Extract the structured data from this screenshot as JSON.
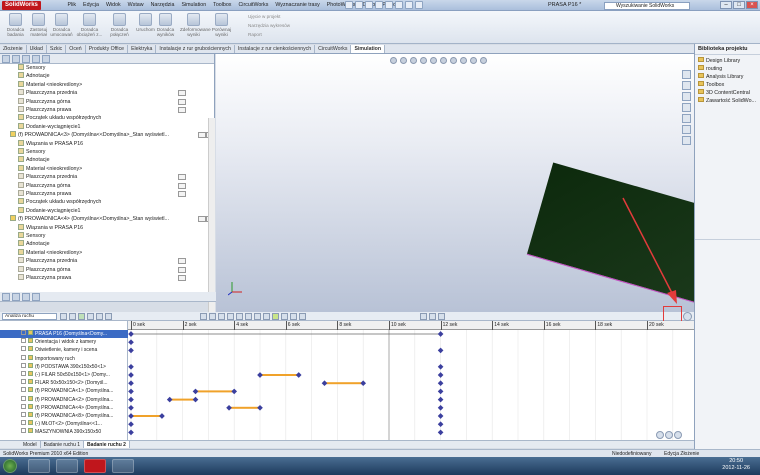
{
  "app": {
    "logo": "SolidWorks",
    "document_title": "PRASA P16 *",
    "search_placeholder": "Wyszukiwanie SolidWorks"
  },
  "menus": [
    "Plik",
    "Edycja",
    "Widok",
    "Wstaw",
    "Narzędzia",
    "Simulation",
    "Toolbox",
    "CircuitWorks",
    "Wyznaczanie trasy",
    "PhotoWorks",
    "Okno",
    "Pomoc"
  ],
  "ribbon": {
    "buttons": [
      {
        "label": "Doradca\nbadania"
      },
      {
        "label": "Zastosuj\nmateriał"
      },
      {
        "label": "Doradca\numocowań"
      },
      {
        "label": "Doradca\nobciążeń z..."
      },
      {
        "label": "Doradca\npołączeń"
      },
      {
        "label": "Uruchom"
      },
      {
        "label": "Doradca\nwyników"
      },
      {
        "label": "Zdeformowane\nwyniki"
      },
      {
        "label": "Porównaj\nwyniki"
      }
    ],
    "small_items": [
      "Ujęcie w projekt",
      "Narzędzia wykresów",
      "Raport"
    ]
  },
  "command_tabs": [
    "Złożenie",
    "Układ",
    "Szkic",
    "Oceń",
    "Produkty Office",
    "Elektryka",
    "Instalacje z rur grubościennych",
    "Instalacje z rur cienkościennych",
    "CircuitWorks",
    "Simulation"
  ],
  "active_tab": "Simulation",
  "feature_tree": [
    {
      "label": "Sensory",
      "type": "folder"
    },
    {
      "label": "Adnotacje",
      "type": "folder"
    },
    {
      "label": "Materiał <nieokreślony>",
      "type": "item"
    },
    {
      "label": "Płaszczyzna przednia",
      "type": "plane"
    },
    {
      "label": "Płaszczyzna górna",
      "type": "plane"
    },
    {
      "label": "Płaszczyzna prawa",
      "type": "plane"
    },
    {
      "label": "Początek układu współrzędnych",
      "type": "item"
    },
    {
      "label": "Dodanie-wyciągnięcie1",
      "type": "item"
    },
    {
      "label": "(f) PROWADNICA<3> (Domyślna<<Domyślna>_Stan wyświetl...",
      "type": "part"
    },
    {
      "label": "Wiązania w PRASA P16",
      "type": "folder"
    },
    {
      "label": "Sensory",
      "type": "folder"
    },
    {
      "label": "Adnotacje",
      "type": "folder"
    },
    {
      "label": "Materiał <nieokreślony>",
      "type": "item"
    },
    {
      "label": "Płaszczyzna przednia",
      "type": "plane"
    },
    {
      "label": "Płaszczyzna górna",
      "type": "plane"
    },
    {
      "label": "Płaszczyzna prawa",
      "type": "plane"
    },
    {
      "label": "Początek układu współrzędnych",
      "type": "item"
    },
    {
      "label": "Dodanie-wyciągnięcie1",
      "type": "item"
    },
    {
      "label": "(f) PROWADNICA<4> (Domyślna<<Domyślna>_Stan wyświetl...",
      "type": "part"
    },
    {
      "label": "Wiązania w PRASA P16",
      "type": "folder"
    },
    {
      "label": "Sensory",
      "type": "folder"
    },
    {
      "label": "Adnotacje",
      "type": "folder"
    },
    {
      "label": "Materiał <nieokreślony>",
      "type": "item"
    },
    {
      "label": "Płaszczyzna przednia",
      "type": "plane"
    },
    {
      "label": "Płaszczyzna górna",
      "type": "plane"
    },
    {
      "label": "Płaszczyzna prawa",
      "type": "plane"
    }
  ],
  "task_pane": {
    "title": "Biblioteka projektu",
    "items": [
      "Design Library",
      "routing",
      "Analysis Library",
      "Toolbox",
      "3D ContentCentral",
      "Zawartość SolidWo..."
    ]
  },
  "motion": {
    "study_type": "Analiza ruchu",
    "time_scale": [
      "0 sek",
      "2 sek",
      "4 sek",
      "6 sek",
      "8 sek",
      "10 sek",
      "12 sek",
      "14 sek",
      "16 sek",
      "18 sek",
      "20 sek"
    ],
    "rows": [
      {
        "label": "PRASA P16 (Domyślna<Domy...",
        "keys": [
          0,
          12
        ],
        "bar": null
      },
      {
        "label": "Orientacja i widok z kamery",
        "keys": [
          0
        ],
        "bar": null
      },
      {
        "label": "Oświetlenie, kamery i scena",
        "keys": [
          0,
          12
        ],
        "bar": null
      },
      {
        "label": "Importowany ruch",
        "keys": [],
        "bar": null
      },
      {
        "label": "(f) PODSTAWA 390x150x50<1>",
        "keys": [
          0,
          12
        ],
        "bar": null
      },
      {
        "label": "(-) FILAR 50x50x150<1> (Domy...",
        "keys": [
          0,
          5,
          6.5,
          12
        ],
        "bar": [
          5,
          6.5
        ]
      },
      {
        "label": "FILAR 50x50x150<2> (Domyśl...",
        "keys": [
          0,
          7.5,
          9,
          12
        ],
        "bar": [
          7.5,
          9
        ]
      },
      {
        "label": "(f) PROWADNICA<1> (Domyślna...",
        "keys": [
          0,
          2.5,
          4,
          12
        ],
        "bar": [
          2.5,
          4
        ]
      },
      {
        "label": "(f) PROWADNICA<2> (Domyślna...",
        "keys": [
          0,
          1.5,
          2.5,
          12
        ],
        "bar": [
          1.5,
          2.5
        ]
      },
      {
        "label": "(f) PROWADNICA<4> (Domyślna...",
        "keys": [
          0,
          3.8,
          5,
          12
        ],
        "bar": [
          3.8,
          5
        ]
      },
      {
        "label": "(f) PROWADNICA<8> (Domyślna...",
        "keys": [
          0,
          1.2,
          12
        ],
        "bar": [
          0,
          1.2
        ]
      },
      {
        "label": "(-) MŁOT<2> (Domyślna<<1...",
        "keys": [
          0,
          12
        ],
        "bar": null
      },
      {
        "label": "MASZYNOWNIA 390x150x50",
        "keys": [
          0,
          12
        ],
        "bar": null
      }
    ],
    "study_tabs": [
      "Model",
      "Badanie ruchu 1",
      "Badanie ruchu 2"
    ],
    "active_study": "Badanie ruchu 2"
  },
  "status": {
    "left": "SolidWorks Premium 2010 x64 Edition",
    "middle": "Niedodefiniowany",
    "right": "Edycja Złożenie"
  },
  "clock": {
    "time": "20:50",
    "date": "2012-11-26"
  },
  "colors": {
    "accent": "#c0161c",
    "panel": "#10300f",
    "keyframe": "#3b3f9e",
    "bar": "#f0a22a",
    "arrow": "#e23b3b"
  }
}
